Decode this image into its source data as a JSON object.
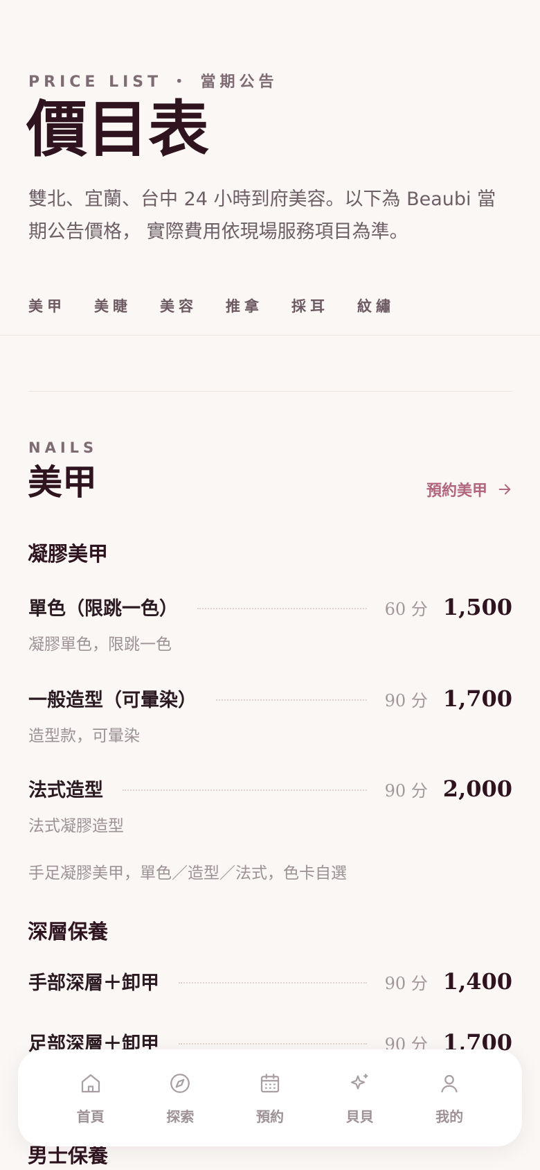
{
  "header": {
    "eyebrow": "PRICE LIST ・ 當期公告",
    "title": "價目表",
    "intro": "雙北、宜蘭、台中 24 小時到府美容。以下為 Beaubi 當期公告價格， 實際費用依現場服務項目為準。"
  },
  "category_tabs": [
    "美甲",
    "美睫",
    "美容",
    "推拿",
    "採耳",
    "紋繡"
  ],
  "section": {
    "eyebrow": "NAILS",
    "title": "美甲",
    "book_label": "預約美甲",
    "accent_color": "#b1657e"
  },
  "groups": [
    {
      "title": "凝膠美甲",
      "items": [
        {
          "name": "單色（限跳一色）",
          "duration": "60 分",
          "price": "1,500",
          "desc": "凝膠單色，限跳一色"
        },
        {
          "name": "一般造型（可暈染）",
          "duration": "90 分",
          "price": "1,700",
          "desc": "造型款，可暈染"
        },
        {
          "name": "法式造型",
          "duration": "90 分",
          "price": "2,000",
          "desc": "法式凝膠造型"
        }
      ],
      "note": "手足凝膠美甲，單色／造型／法式，色卡自選"
    },
    {
      "title": "深層保養",
      "items": [
        {
          "name": "手部深層＋卸甲",
          "duration": "90 分",
          "price": "1,400"
        },
        {
          "name": "足部深層＋卸甲",
          "duration": "90 分",
          "price": "1,700"
        }
      ]
    },
    {
      "title": "男士保養"
    }
  ],
  "tabbar": {
    "items": [
      {
        "label": "首頁",
        "icon": "home-icon"
      },
      {
        "label": "探索",
        "icon": "compass-icon"
      },
      {
        "label": "預約",
        "icon": "calendar-icon"
      },
      {
        "label": "貝貝",
        "icon": "sparkle-icon"
      },
      {
        "label": "我的",
        "icon": "user-icon"
      }
    ]
  }
}
